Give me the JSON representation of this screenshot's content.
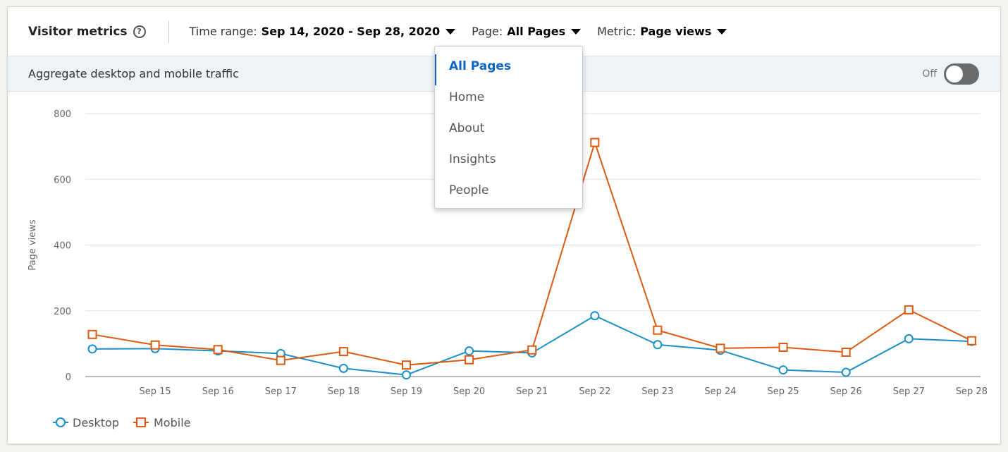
{
  "header": {
    "title": "Visitor metrics",
    "time_range_label": "Time range:",
    "time_range_value": "Sep 14, 2020 - Sep 28, 2020",
    "page_label": "Page:",
    "page_value": "All Pages",
    "metric_label": "Metric:",
    "metric_value": "Page views"
  },
  "band": {
    "text": "Aggregate desktop and mobile traffic",
    "toggle_label": "Off"
  },
  "dropdown": {
    "items": [
      "All Pages",
      "Home",
      "About",
      "Insights",
      "People"
    ],
    "selected": "All Pages"
  },
  "colors": {
    "desktop": "#1a90c6",
    "mobile": "#dd5a12",
    "accent": "#0a66c2"
  },
  "chart_data": {
    "type": "line",
    "title": "",
    "xlabel": "",
    "ylabel": "Page views",
    "ylim": [
      0,
      800
    ],
    "yticks": [
      0,
      200,
      400,
      600,
      800
    ],
    "grid": true,
    "legend_position": "bottom-left",
    "x": [
      "Sep 14",
      "Sep 15",
      "Sep 16",
      "Sep 17",
      "Sep 18",
      "Sep 19",
      "Sep 20",
      "Sep 21",
      "Sep 22",
      "Sep 23",
      "Sep 24",
      "Sep 25",
      "Sep 26",
      "Sep 27",
      "Sep 28"
    ],
    "x_tick_labels": [
      "",
      "Sep 15",
      "Sep 16",
      "Sep 17",
      "Sep 18",
      "Sep 19",
      "Sep 20",
      "Sep 21",
      "Sep 22",
      "Sep 23",
      "Sep 24",
      "Sep 25",
      "Sep 26",
      "Sep 27",
      "Sep 28"
    ],
    "series": [
      {
        "name": "Desktop",
        "marker": "circle",
        "values": [
          84,
          85,
          78,
          70,
          25,
          5,
          78,
          72,
          185,
          97,
          80,
          20,
          13,
          115,
          107
        ]
      },
      {
        "name": "Mobile",
        "marker": "square",
        "values": [
          128,
          96,
          82,
          49,
          76,
          35,
          51,
          81,
          712,
          141,
          86,
          89,
          74,
          203,
          109
        ]
      }
    ]
  }
}
